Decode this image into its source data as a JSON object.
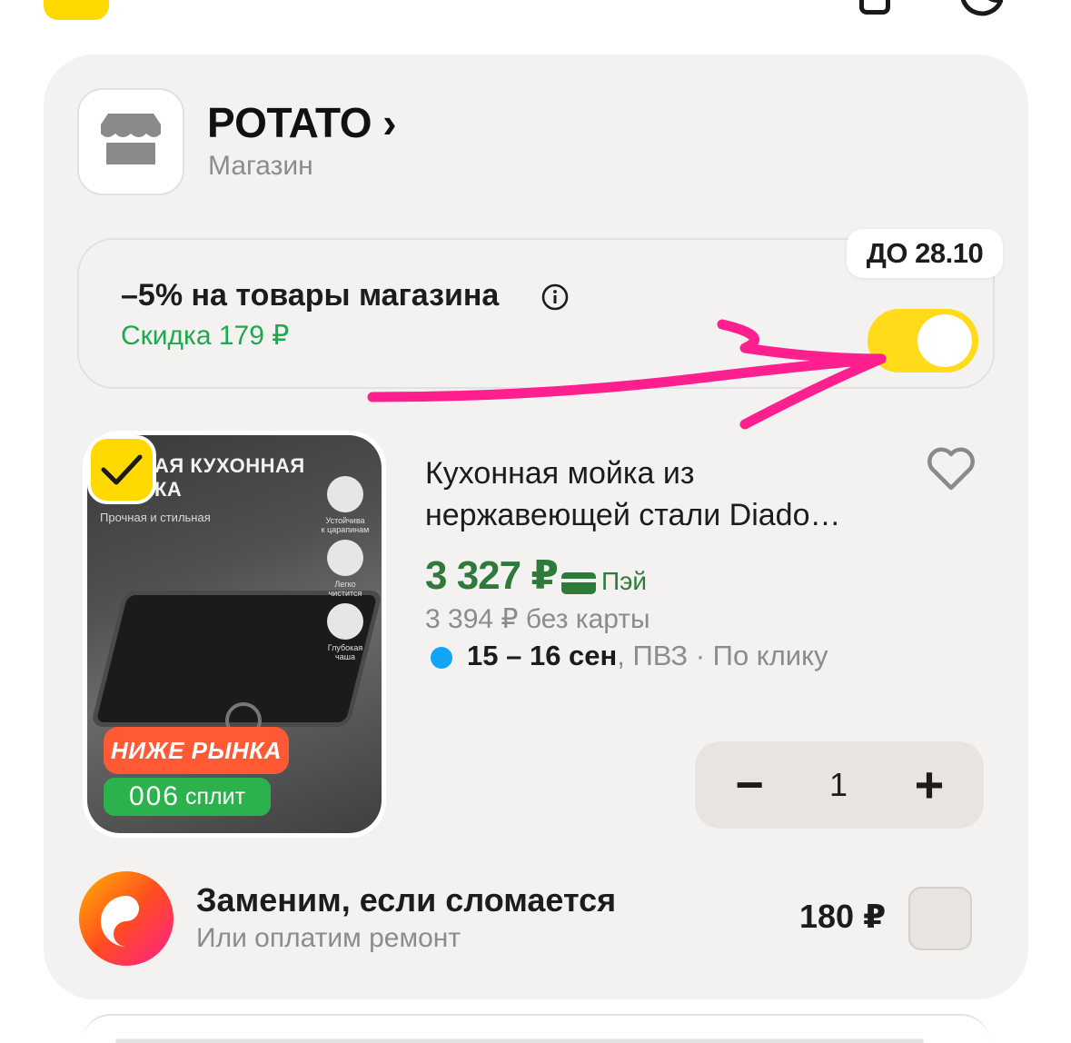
{
  "header": {
    "icons": [
      "checkbox-icon",
      "bag-icon",
      "moon-icon"
    ]
  },
  "shop": {
    "name": "POTATO ›",
    "subtitle": "Магазин",
    "logo_icon": "store-icon"
  },
  "promo": {
    "title": "–5% на товары магазина",
    "discount": "Скидка 179 ₽",
    "until": "ДО 28.10",
    "toggle_on": true,
    "toggle_color": "#ffdb1a"
  },
  "product": {
    "image_headline": "АЯ КУХОННАЯ\nКА",
    "image_subtitle": "Прочная и стильная",
    "features": [
      "Устойчива\nк царапинам",
      "Легко\nчистится",
      "Глубокая\nчаша"
    ],
    "badge_market": "НИЖЕ РЫНКА",
    "badge_split_number": "006",
    "badge_split_label": "сплит",
    "title": "Кухонная мойка из нержавеющей стали Diado…",
    "price": "3 327 ₽",
    "pay_label": "Пэй",
    "price_color": "#2f7a3a",
    "old_price": "3 394 ₽  без карты",
    "delivery_dates": "15 – 16 сен",
    "delivery_rest": ", ПВЗ · По клику",
    "quantity": "1",
    "minus_label": "−",
    "plus_label": "+",
    "selected": true
  },
  "warranty": {
    "title": "Заменим, если сломается",
    "subtitle": "Или оплатим ремонт",
    "price": "180 ₽",
    "checked": false
  }
}
